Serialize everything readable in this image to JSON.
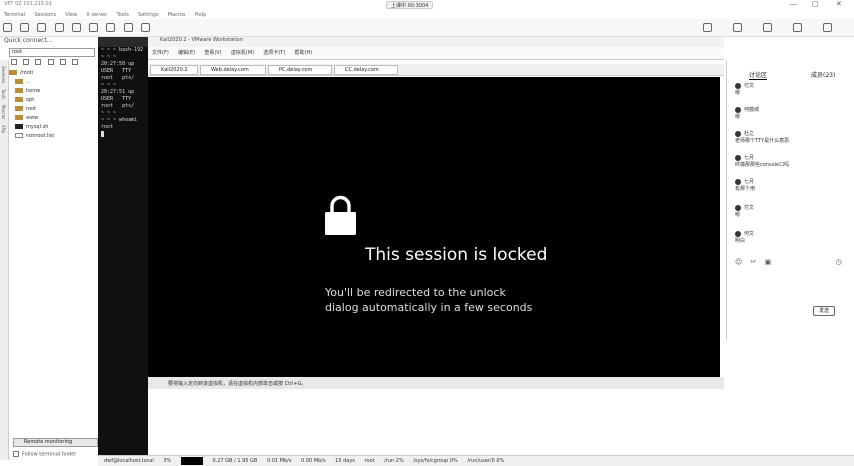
{
  "app": {
    "window_title": "VPT 0Z 101.215.01",
    "live_badge": "上课中 00:3004"
  },
  "menu": [
    "Terminal",
    "Sessions",
    "View",
    "X server",
    "Tools",
    "Settings",
    "Macros",
    "Help"
  ],
  "sidebar": {
    "quick_connect": "Quick connect...",
    "search_value": "root",
    "strip_tabs": [
      "Sessions",
      "Tools",
      "Macros",
      "Sftp"
    ],
    "tree": [
      {
        "name": "/root/",
        "kind": "folder"
      },
      {
        "name": "..",
        "kind": "folder"
      },
      {
        "name": "home",
        "kind": "folder"
      },
      {
        "name": "opt",
        "kind": "folder"
      },
      {
        "name": "root",
        "kind": "folder"
      },
      {
        "name": "www",
        "kind": "folder"
      },
      {
        "name": "mysql.sh",
        "kind": "file"
      },
      {
        "name": "nonroot.list",
        "kind": "file"
      }
    ],
    "remote_monitoring": "Remote monitoring",
    "follow_folder": "Follow terminal folder"
  },
  "terminal": {
    "lines": [
      "~ ~ ~ bash-192",
      "~ ~ ~",
      "20:27:50 up",
      "USER   TTY",
      "root   pts/",
      "~ ~ ~",
      "20:27:51 up",
      "USER   TTY",
      "root   pts/",
      "~ ~ ~",
      "~ ~ ~ whoami",
      "root",
      ""
    ]
  },
  "vmware": {
    "title": "Kali2020.2 - VMware Workstation",
    "menu": [
      "文件(F)",
      "编辑(E)",
      "查看(V)",
      "虚拟机(M)",
      "选项卡(T)",
      "帮助(H)"
    ],
    "tabs": [
      "Kali2020.2",
      "Web.delay.com",
      "PC.delay.com",
      "CC.delay.com"
    ],
    "lock_title": "This session is locked",
    "lock_line1": "You'll be redirected to the unlock",
    "lock_line2": "dialog automatically in a few seconds",
    "status": "要将输入定向到该虚拟机，请在虚拟机内部单击或按 Ctrl+G。"
  },
  "chat": {
    "tabs": [
      "讨论区",
      "成员(23)"
    ],
    "messages": [
      {
        "user": "付文",
        "text": "嗯"
      },
      {
        "user": "何蕴城",
        "text": "嗯"
      },
      {
        "user": "杜之",
        "text": "老师那个TTY是什么意思"
      },
      {
        "user": "七月",
        "text": "终端那那些console口吗"
      },
      {
        "user": "七月",
        "text": "有那个用"
      },
      {
        "user": "付文",
        "text": "嗯"
      },
      {
        "user": "何文",
        "text": "明白"
      }
    ],
    "send_label": "发送"
  },
  "statusbar": [
    "dwf@localhost.local",
    "3%",
    "0.27 GB / 1.95 GB",
    "0.01 Mb/s",
    "0.00 Mb/s",
    "15 days",
    "root",
    "/run 2%",
    "/sys/fs/cgroup 0%",
    "/run/user/0 0%"
  ]
}
